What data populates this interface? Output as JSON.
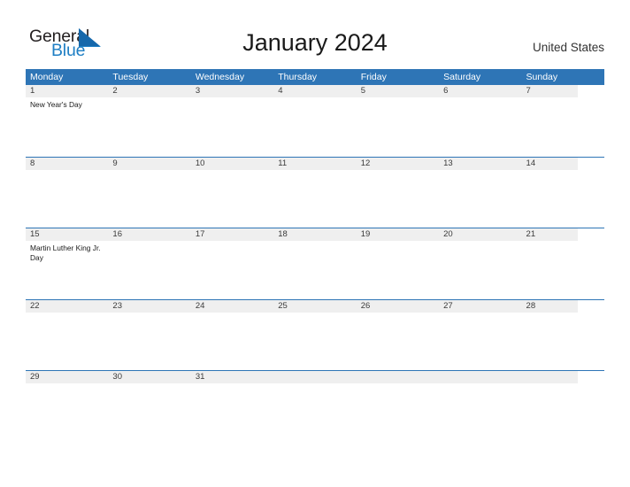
{
  "logo": {
    "word_primary": "General",
    "word_secondary": "Blue",
    "flag_icon": "blue-flag-triangle-icon",
    "primary_color": "#231f20",
    "secondary_color": "#1f7fc4"
  },
  "header": {
    "title": "January 2024",
    "country": "United States"
  },
  "theme": {
    "header_blue": "#2e75b6",
    "band_gray": "#efefef",
    "page_background": "#ffffff",
    "text_color": "#1a1a1a"
  },
  "calendar": {
    "weekdays": [
      "Monday",
      "Tuesday",
      "Wednesday",
      "Thursday",
      "Friday",
      "Saturday",
      "Sunday"
    ],
    "weeks": [
      {
        "days": [
          {
            "number": "1",
            "events": [
              "New Year's Day"
            ]
          },
          {
            "number": "2",
            "events": []
          },
          {
            "number": "3",
            "events": []
          },
          {
            "number": "4",
            "events": []
          },
          {
            "number": "5",
            "events": []
          },
          {
            "number": "6",
            "events": []
          },
          {
            "number": "7",
            "events": []
          }
        ]
      },
      {
        "days": [
          {
            "number": "8",
            "events": []
          },
          {
            "number": "9",
            "events": []
          },
          {
            "number": "10",
            "events": []
          },
          {
            "number": "11",
            "events": []
          },
          {
            "number": "12",
            "events": []
          },
          {
            "number": "13",
            "events": []
          },
          {
            "number": "14",
            "events": []
          }
        ]
      },
      {
        "days": [
          {
            "number": "15",
            "events": [
              "Martin Luther King Jr. Day"
            ]
          },
          {
            "number": "16",
            "events": []
          },
          {
            "number": "17",
            "events": []
          },
          {
            "number": "18",
            "events": []
          },
          {
            "number": "19",
            "events": []
          },
          {
            "number": "20",
            "events": []
          },
          {
            "number": "21",
            "events": []
          }
        ]
      },
      {
        "days": [
          {
            "number": "22",
            "events": []
          },
          {
            "number": "23",
            "events": []
          },
          {
            "number": "24",
            "events": []
          },
          {
            "number": "25",
            "events": []
          },
          {
            "number": "26",
            "events": []
          },
          {
            "number": "27",
            "events": []
          },
          {
            "number": "28",
            "events": []
          }
        ]
      },
      {
        "days": [
          {
            "number": "29",
            "events": []
          },
          {
            "number": "30",
            "events": []
          },
          {
            "number": "31",
            "events": []
          },
          {
            "number": "",
            "events": []
          },
          {
            "number": "",
            "events": []
          },
          {
            "number": "",
            "events": []
          },
          {
            "number": "",
            "events": []
          }
        ]
      }
    ]
  }
}
